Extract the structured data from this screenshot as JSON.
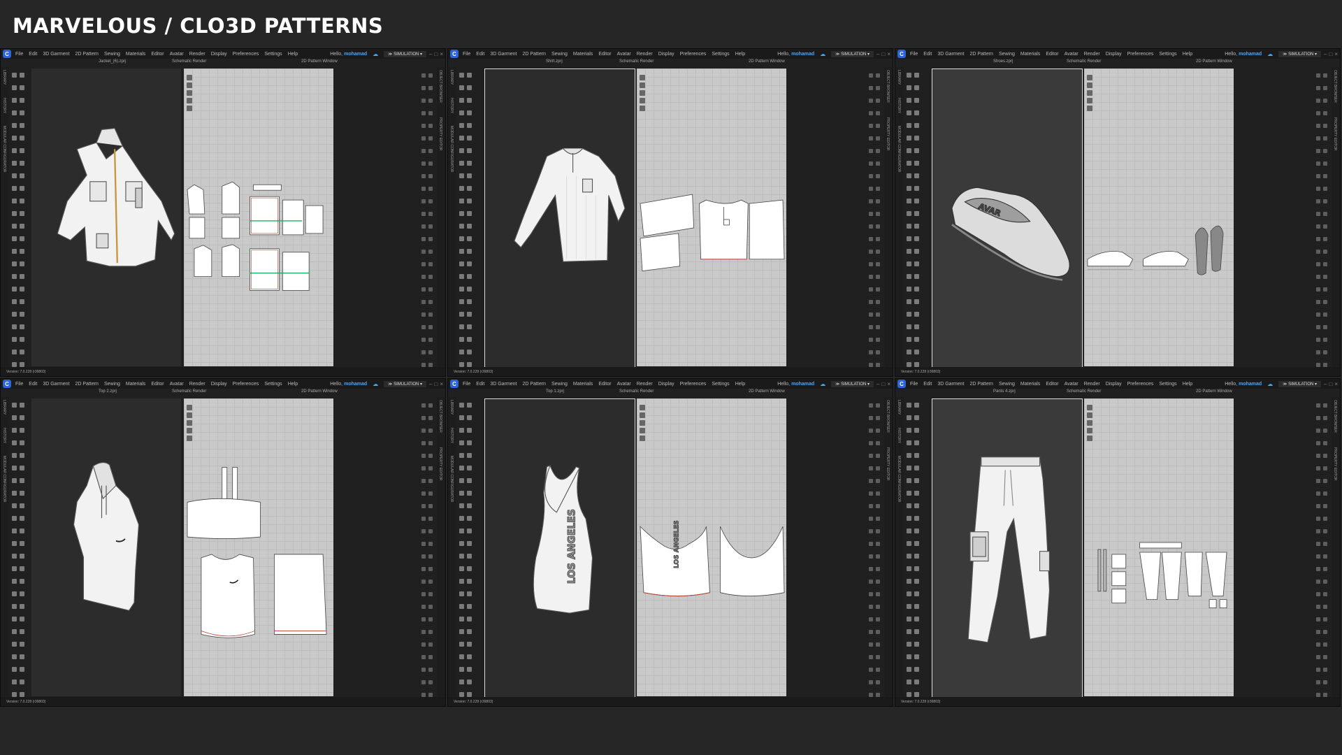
{
  "page_title": "MARVELOUS / CLO3D PATTERNS",
  "app": {
    "menu": [
      "File",
      "Edit",
      "3D Garment",
      "2D Pattern",
      "Sewing",
      "Materials",
      "Editor",
      "Avatar",
      "Render",
      "Display",
      "Preferences",
      "Settings",
      "Help"
    ],
    "greeting": "Hello,",
    "user": "mohamad",
    "mode": "SIMULATION",
    "view3d_label": "Schematic Render",
    "view2d_label": "2D Pattern Window",
    "left_tabs": [
      "LIBRARY",
      "HISTORY",
      "MODULAR CONFIGURATOR"
    ],
    "right_tabs": [
      "OBJECT BROWSER",
      "PROPERTY EDITOR"
    ],
    "version": "Version: 7.0.228 (r39803)"
  },
  "windows": [
    {
      "file": "Jacket_(6).zprj",
      "garment": "jacket"
    },
    {
      "file": "Shirt.zprj",
      "garment": "shirt"
    },
    {
      "file": "Shoes.zprj",
      "garment": "shoes"
    },
    {
      "file": "Top 2.zprj",
      "garment": "top2"
    },
    {
      "file": "Top 1.zprj",
      "garment": "top1",
      "print_text": "LOS ANGELES"
    },
    {
      "file": "Pants 4.zprj",
      "garment": "pants"
    }
  ],
  "colors": {
    "background": "#262626",
    "brand": "#2d64d6",
    "accent": "#4aa7ff",
    "seam": "#c0392b",
    "grainline": "#27ae60"
  }
}
